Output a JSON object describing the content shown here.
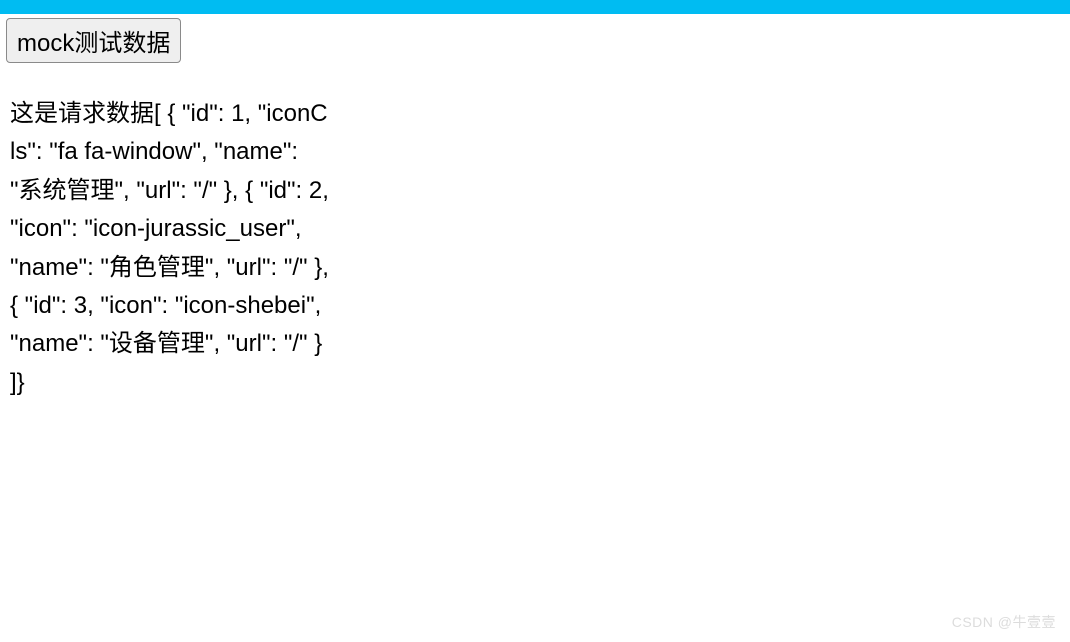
{
  "topbar": {
    "color": "#00bcf2"
  },
  "toolbar": {
    "mock_button_label": "mock测试数据"
  },
  "content": {
    "request_text": "这是请求数据[ { \"id\": 1, \"iconCls\": \"fa fa-window\", \"name\": \"系统管理\", \"url\": \"/\" }, { \"id\": 2, \"icon\": \"icon-jurassic_user\", \"name\": \"角色管理\", \"url\": \"/\" }, { \"id\": 3, \"icon\": \"icon-shebei\", \"name\": \"设备管理\", \"url\": \"/\" } ]}"
  },
  "watermark": {
    "text": "CSDN @牛壹壹"
  }
}
